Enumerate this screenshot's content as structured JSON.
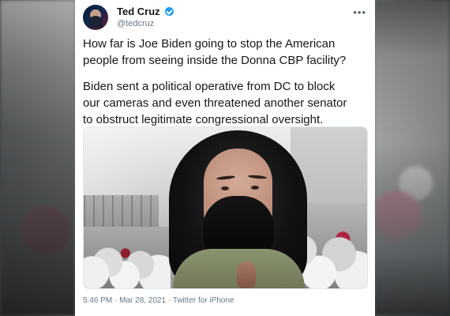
{
  "author": {
    "display_name": "Ted Cruz",
    "handle": "@tedcruz"
  },
  "tweet": {
    "paragraph_1": "How far is Joe Biden going to stop the American people from seeing inside the Donna CBP facility?",
    "paragraph_2": "Biden sent a political operative from DC to block our cameras and even threatened another senator to obstruct legitimate congressional oversight.",
    "timestamp": "5:46 PM · Mar 28, 2021 · Twitter for iPhone"
  },
  "icons": {
    "avatar": "avatar",
    "verified": "verified-icon",
    "more": "more-options-icon"
  },
  "colors": {
    "text_primary": "#14171a",
    "text_secondary": "#657786",
    "verified_blue": "#1d9bf0"
  }
}
